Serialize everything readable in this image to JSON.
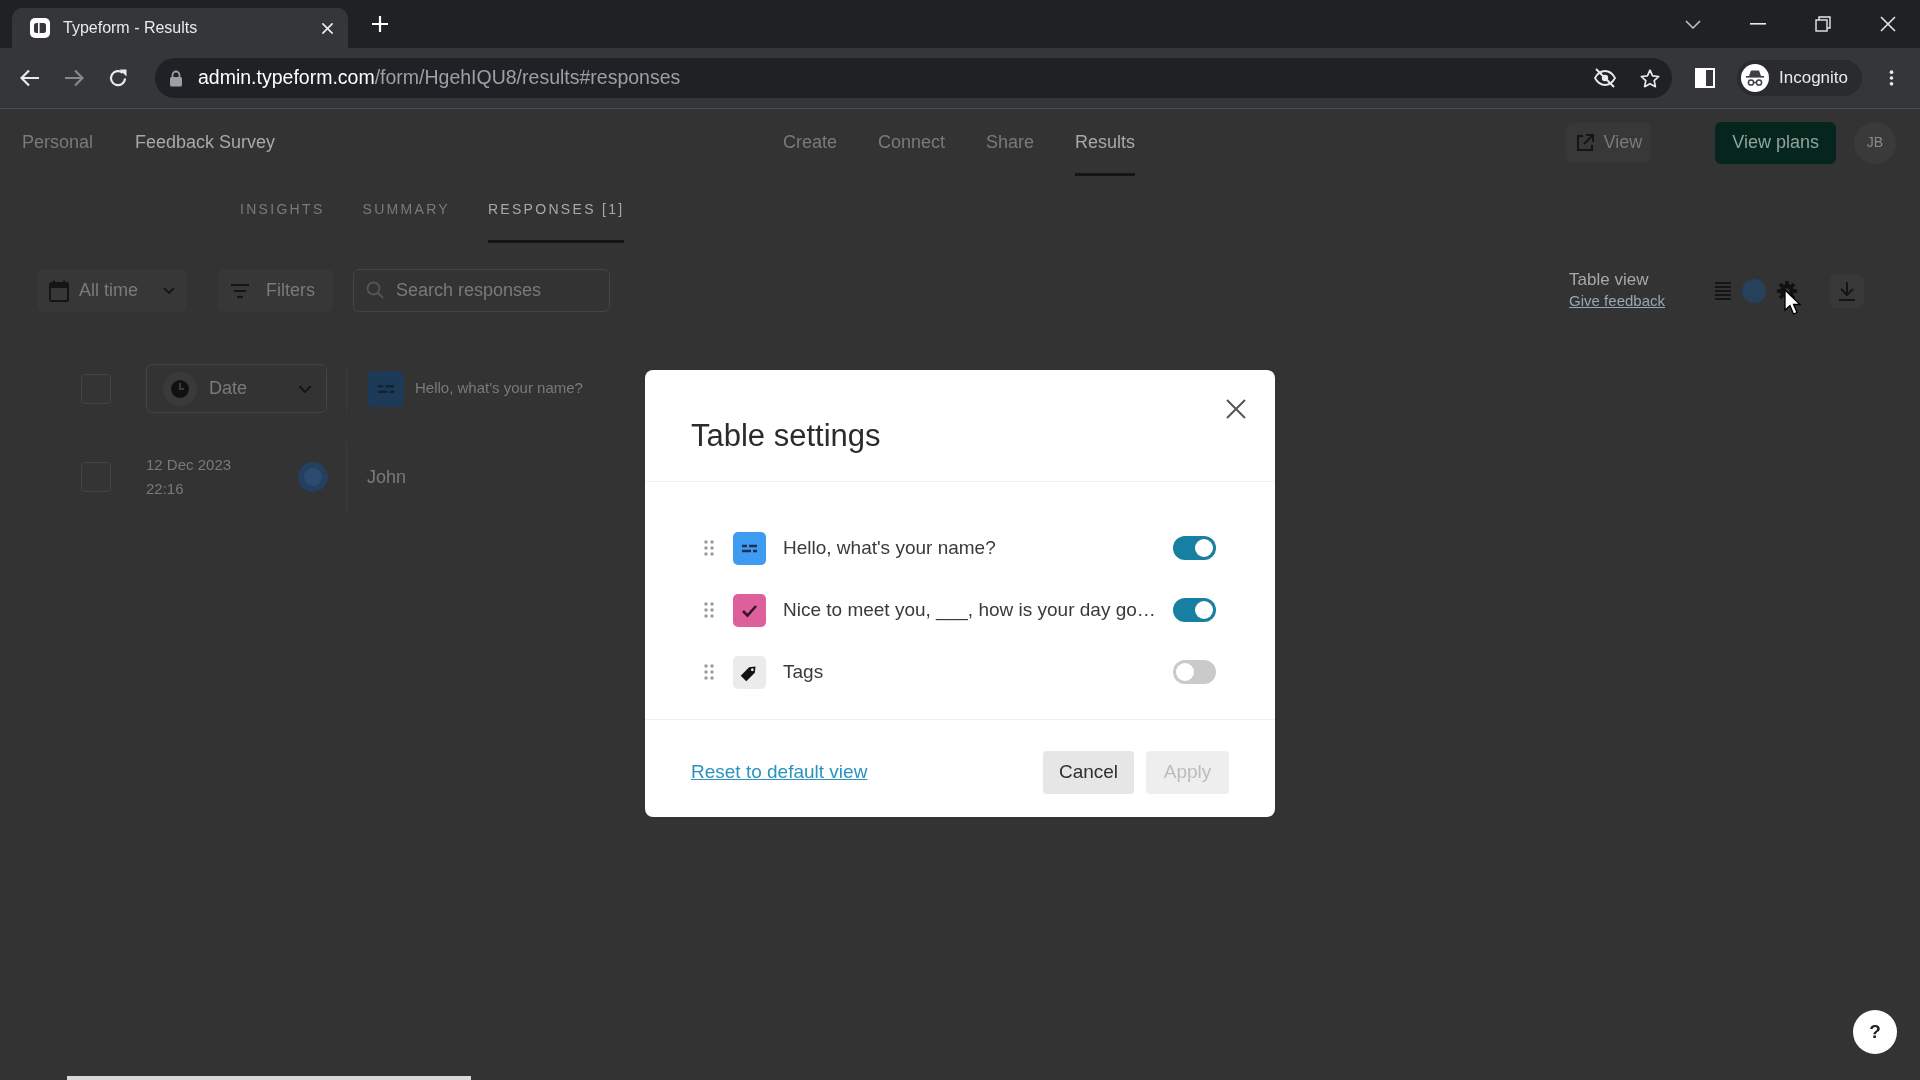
{
  "browser": {
    "tab": {
      "title": "Typeform - Results"
    },
    "address": {
      "host": "admin.typeform.com",
      "path": "/form/HgehIQU8/results#responses"
    },
    "profile": {
      "label": "Incognito"
    }
  },
  "header": {
    "workspace": "Personal",
    "form_title": "Feedback Survey",
    "nav": [
      {
        "label": "Create",
        "selected": false
      },
      {
        "label": "Connect",
        "selected": false
      },
      {
        "label": "Share",
        "selected": false
      },
      {
        "label": "Results",
        "selected": true
      }
    ],
    "view_button": "View",
    "plans_button": "View plans",
    "avatar_initials": "JB"
  },
  "result_tabs": [
    {
      "label": "INSIGHTS",
      "selected": false
    },
    {
      "label": "SUMMARY",
      "selected": false
    },
    {
      "label": "RESPONSES [1]",
      "selected": true
    }
  ],
  "toolbar": {
    "date_range": "All time",
    "filters_button": "Filters",
    "search": {
      "placeholder": "Search responses"
    },
    "view_label": "Table view",
    "feedback_link": "Give feedback"
  },
  "table": {
    "select_all": {
      "checked": false
    },
    "columns": [
      {
        "kind": "date",
        "label": "Date"
      },
      {
        "kind": "short_text",
        "label": "Hello, what's your name?"
      }
    ],
    "rows": [
      {
        "checked": false,
        "date": "12 Dec 2023",
        "time": "22:16",
        "answer": "John"
      }
    ]
  },
  "dialog": {
    "title": "Table settings",
    "fields": [
      {
        "kind": "short_text",
        "label": "Hello, what's your name?",
        "on": true
      },
      {
        "kind": "multiple_choice",
        "label": "Nice to meet you, ___, how is your day go…",
        "on": true
      },
      {
        "kind": "tags",
        "label": "Tags",
        "on": false
      }
    ],
    "reset_link": "Reset to default view",
    "buttons": [
      {
        "label": "Cancel",
        "disabled": false
      },
      {
        "label": "Apply",
        "disabled": true
      }
    ]
  },
  "help_button": {
    "label": "?"
  }
}
